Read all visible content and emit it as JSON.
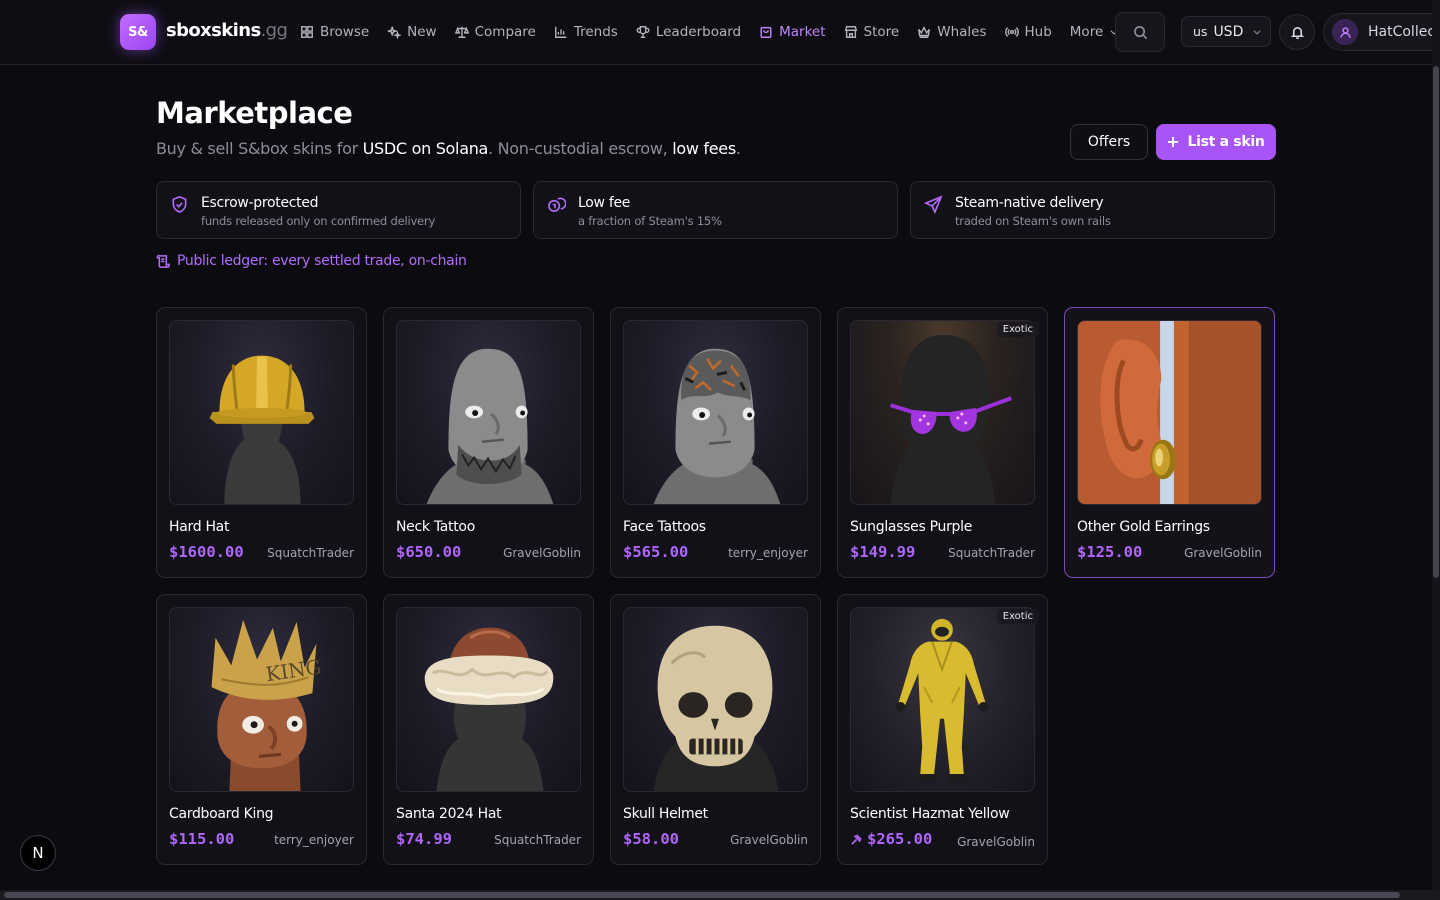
{
  "brand": {
    "badge": "S&",
    "name": "sboxskins",
    "tld": ".gg",
    "accent": "#a855f7"
  },
  "nav": {
    "links": [
      {
        "label": "Browse",
        "icon": "grid-icon"
      },
      {
        "label": "New",
        "icon": "sparkles-icon"
      },
      {
        "label": "Compare",
        "icon": "scale-icon"
      },
      {
        "label": "Trends",
        "icon": "bar-chart-icon"
      },
      {
        "label": "Leaderboard",
        "icon": "trophy-icon"
      },
      {
        "label": "Market",
        "icon": "shopping-bag-icon",
        "active": true
      },
      {
        "label": "Store",
        "icon": "store-icon"
      },
      {
        "label": "Whales",
        "icon": "crown-icon"
      },
      {
        "label": "Hub",
        "icon": "broadcast-icon"
      },
      {
        "label": "More",
        "icon": "chevron-down-icon"
      }
    ],
    "currency": {
      "flag": "us",
      "code": "USD"
    },
    "user": {
      "name": "HatCollector"
    }
  },
  "header": {
    "title": "Marketplace",
    "subtitle": {
      "part1": "Buy & sell S&box skins for ",
      "bold1": "USDC on Solana",
      "part2": ". Non-custodial escrow, ",
      "bold2": "low fees",
      "part3": "."
    },
    "offers_label": "Offers",
    "list_label": "List a skin"
  },
  "features": [
    {
      "title": "Escrow-protected",
      "subtitle": "funds released only on confirmed delivery",
      "icon": "shield-check-icon"
    },
    {
      "title": "Low fee",
      "subtitle": "a fraction of Steam's 15%",
      "icon": "coins-icon"
    },
    {
      "title": "Steam-native delivery",
      "subtitle": "traded on Steam's own rails",
      "icon": "send-icon"
    }
  ],
  "ledger_link": "Public ledger: every settled trade, on-chain",
  "listings": [
    {
      "name": "Hard Hat",
      "price": "$1600.00",
      "seller": "SquatchTrader",
      "exotic": false,
      "art": "hardhat"
    },
    {
      "name": "Neck Tattoo",
      "price": "$650.00",
      "seller": "GravelGoblin",
      "exotic": false,
      "art": "necktattoo"
    },
    {
      "name": "Face Tattoos",
      "price": "$565.00",
      "seller": "terry_enjoyer",
      "exotic": false,
      "art": "facetattoo"
    },
    {
      "name": "Sunglasses Purple",
      "price": "$149.99",
      "seller": "SquatchTrader",
      "exotic": true,
      "exotic_label": "Exotic",
      "art": "sunglasses"
    },
    {
      "name": "Other Gold Earrings",
      "price": "$125.00",
      "seller": "GravelGoblin",
      "exotic": false,
      "art": "earring",
      "selected": true
    },
    {
      "name": "Cardboard King",
      "price": "$115.00",
      "seller": "terry_enjoyer",
      "exotic": false,
      "art": "cardking"
    },
    {
      "name": "Santa 2024 Hat",
      "price": "$74.99",
      "seller": "SquatchTrader",
      "exotic": false,
      "art": "santahat"
    },
    {
      "name": "Skull Helmet",
      "price": "$58.00",
      "seller": "GravelGoblin",
      "exotic": false,
      "art": "skull"
    },
    {
      "name": "Scientist Hazmat Yellow",
      "price": "$265.00",
      "seller": "GravelGoblin",
      "exotic": true,
      "exotic_label": "Exotic",
      "art": "hazmat",
      "bid_icon": true
    }
  ],
  "dev_badge": "N"
}
